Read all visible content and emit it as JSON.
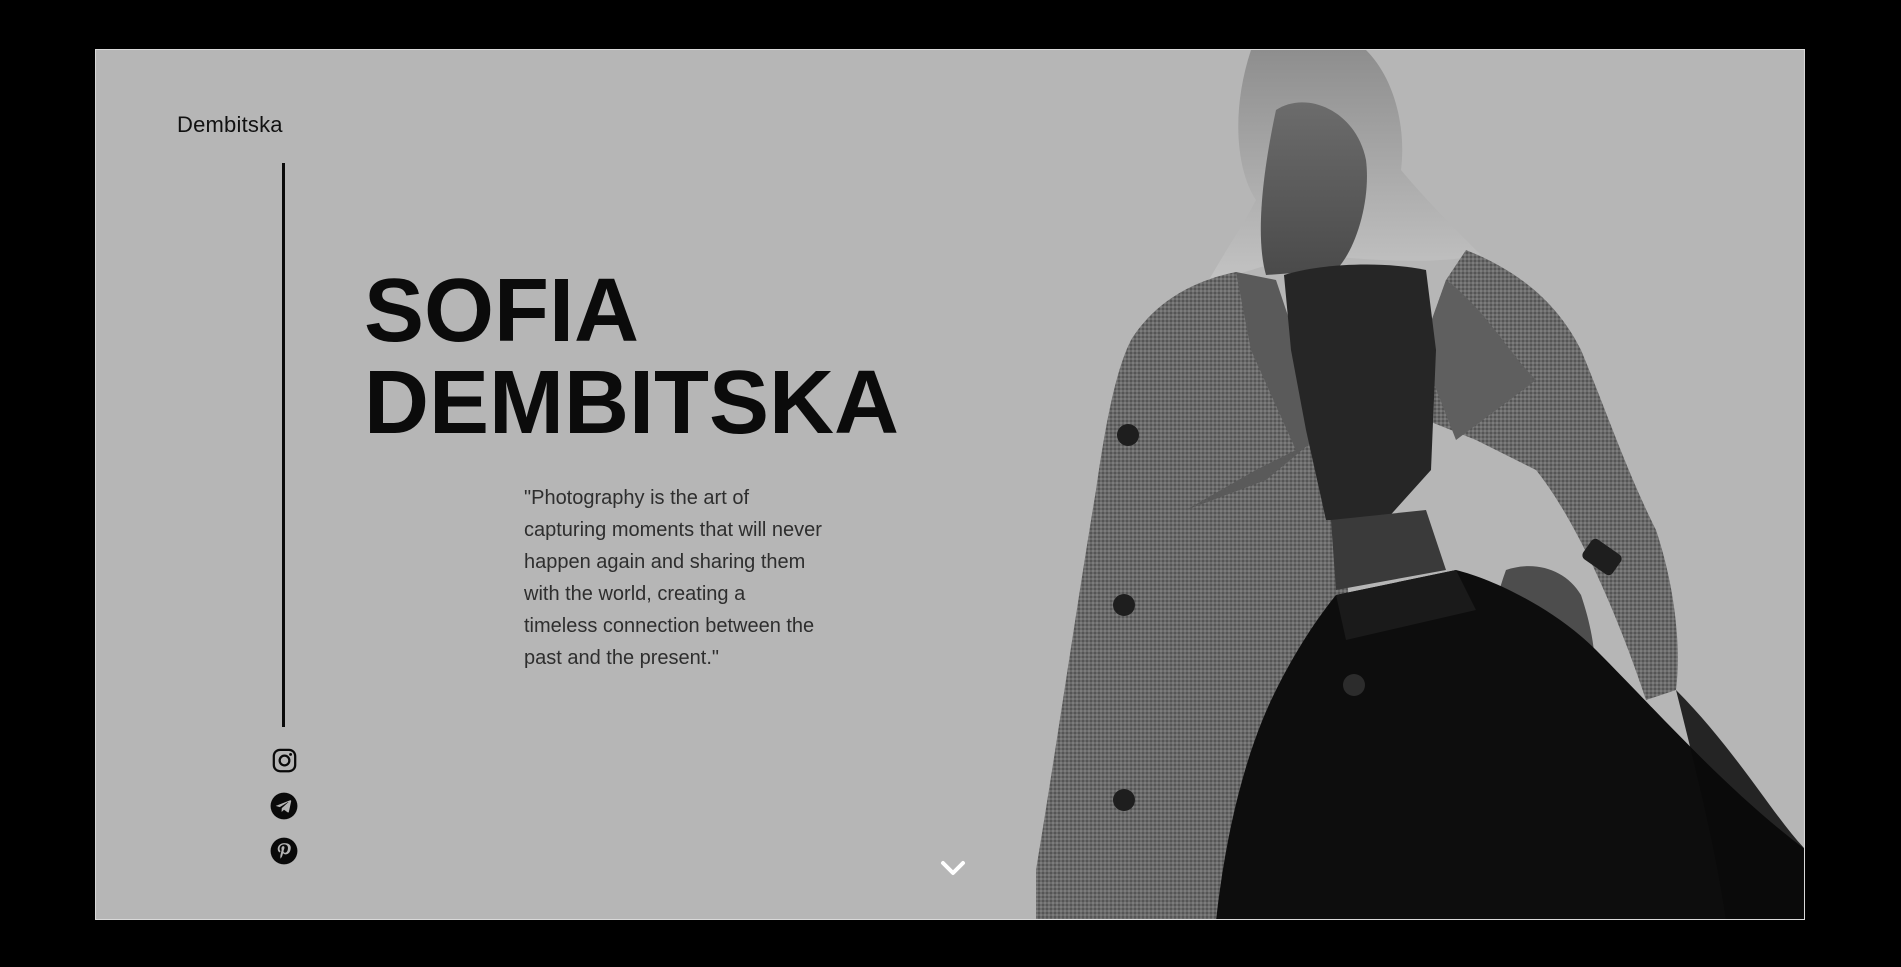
{
  "brand": {
    "name": "Dembitska"
  },
  "hero": {
    "first_name": "SOFIA",
    "last_name": "DEMBITSKA",
    "quote": "\"Photography is the art of capturing moments that will never happen again and sharing them with the world, creating a timeless connection between the past and the present.\""
  },
  "social": [
    {
      "icon": "instagram-icon"
    },
    {
      "icon": "telegram-icon"
    },
    {
      "icon": "pinterest-icon"
    }
  ],
  "colors": {
    "page_background": "#000000",
    "frame_background": "#b6b6b6",
    "text_dark": "#0b0b0b",
    "quote_text": "#2e2e2e",
    "scroll_arrow": "#ffffff"
  }
}
